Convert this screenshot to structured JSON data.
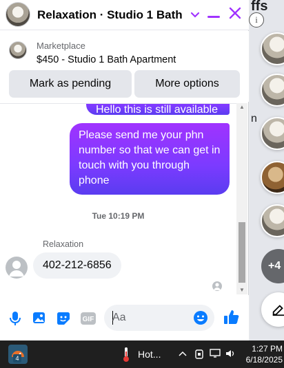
{
  "background": {
    "title_fragment": "ffs",
    "info_glyph": "i",
    "side_char": "n",
    "more_chats_label": "+4"
  },
  "chat": {
    "title": "Relaxation · Studio 1 Bath ...",
    "marketplace": {
      "label": "Marketplace",
      "listing": "$450 - Studio 1 Bath Apartment",
      "mark_pending": "Mark as pending",
      "more_options": "More options"
    },
    "messages": [
      {
        "from": "me",
        "text": "Hello this is still available"
      },
      {
        "from": "me",
        "text": "Please send me your phn number so that we can get in touch with you through phone"
      }
    ],
    "time_separator": "Tue 10:19 PM",
    "incoming": {
      "sender": "Relaxation",
      "text": "402-212-6856"
    },
    "composer": {
      "placeholder": "Aa",
      "gif_label": "GIF"
    },
    "accent_color": "#a033ff"
  },
  "taskbar": {
    "app_badge": "4",
    "weather": "Hot...",
    "time": "1:27 PM",
    "date": "6/18/2025"
  }
}
